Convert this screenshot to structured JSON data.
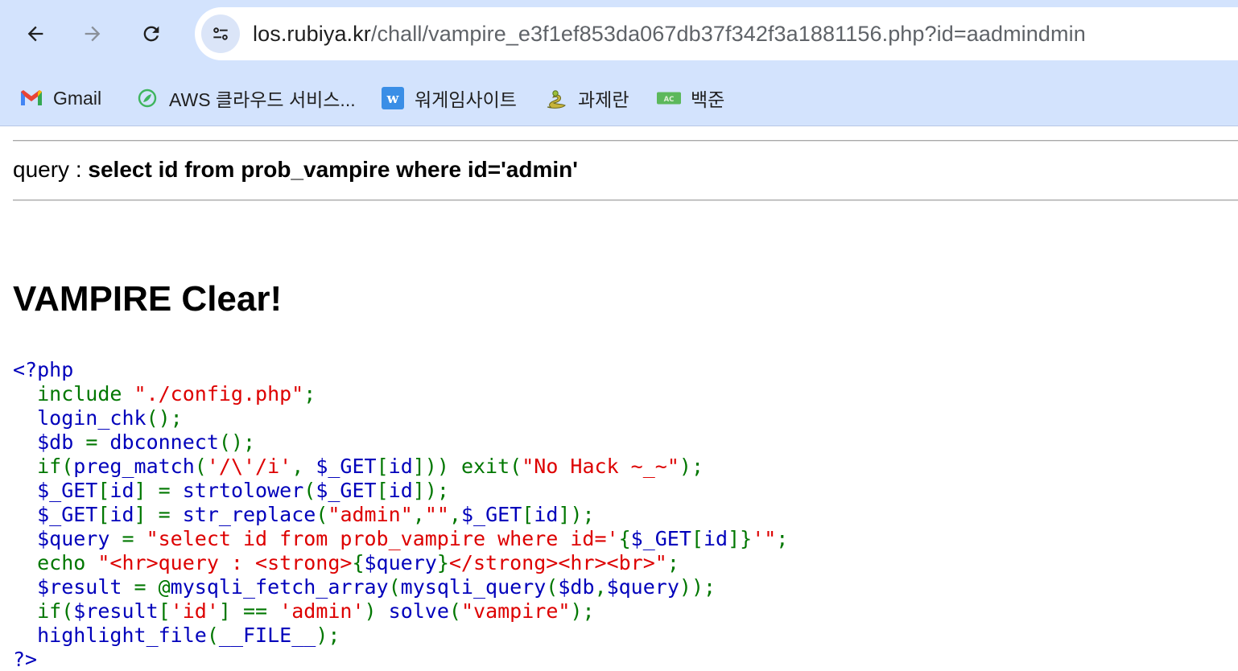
{
  "browser": {
    "url_host": "los.rubiya.kr",
    "url_path": "/chall/vampire_e3f1ef853da067db37f342f3a1881156.php?id=aadmindmin",
    "back_icon": "arrow-left-icon",
    "forward_icon": "arrow-right-icon",
    "reload_icon": "reload-icon",
    "site_info_icon": "tune-icon",
    "bookmarks": [
      {
        "label": "Gmail",
        "icon": "gmail-icon"
      },
      {
        "label": "AWS 클라우드 서비스...",
        "icon": "aws-leaf-icon"
      },
      {
        "label": "워게임사이트",
        "icon": "w-icon"
      },
      {
        "label": "과제란",
        "icon": "snake-icon"
      },
      {
        "label": "백준",
        "icon": "ac-icon"
      }
    ]
  },
  "page": {
    "query_prefix": "query : ",
    "query_text": "select id from prob_vampire where id='admin'",
    "clear_title": "VAMPIRE Clear!",
    "code_lines": [
      [
        [
          "d",
          "<?php"
        ]
      ],
      [
        [
          "k",
          "  include "
        ],
        [
          "s",
          "\"./config.php\""
        ],
        [
          "k",
          ";"
        ]
      ],
      [
        [
          "d",
          "  login_chk"
        ],
        [
          "k",
          "();"
        ]
      ],
      [
        [
          "d",
          "  $db "
        ],
        [
          "k",
          "= "
        ],
        [
          "d",
          "dbconnect"
        ],
        [
          "k",
          "();"
        ]
      ],
      [
        [
          "k",
          "  if("
        ],
        [
          "d",
          "preg_match"
        ],
        [
          "k",
          "("
        ],
        [
          "s",
          "'/\\'/i'"
        ],
        [
          "k",
          ", "
        ],
        [
          "d",
          "$_GET"
        ],
        [
          "k",
          "["
        ],
        [
          "d",
          "id"
        ],
        [
          "k",
          "])) exit("
        ],
        [
          "s",
          "\"No Hack ~_~\""
        ],
        [
          "k",
          ");"
        ]
      ],
      [
        [
          "d",
          "  $_GET"
        ],
        [
          "k",
          "["
        ],
        [
          "d",
          "id"
        ],
        [
          "k",
          "] = "
        ],
        [
          "d",
          "strtolower"
        ],
        [
          "k",
          "("
        ],
        [
          "d",
          "$_GET"
        ],
        [
          "k",
          "["
        ],
        [
          "d",
          "id"
        ],
        [
          "k",
          "]);"
        ]
      ],
      [
        [
          "d",
          "  $_GET"
        ],
        [
          "k",
          "["
        ],
        [
          "d",
          "id"
        ],
        [
          "k",
          "] = "
        ],
        [
          "d",
          "str_replace"
        ],
        [
          "k",
          "("
        ],
        [
          "s",
          "\"admin\""
        ],
        [
          "k",
          ","
        ],
        [
          "s",
          "\"\""
        ],
        [
          "k",
          ","
        ],
        [
          "d",
          "$_GET"
        ],
        [
          "k",
          "["
        ],
        [
          "d",
          "id"
        ],
        [
          "k",
          "]);"
        ]
      ],
      [
        [
          "d",
          "  $query "
        ],
        [
          "k",
          "= "
        ],
        [
          "s",
          "\"select id from prob_vampire where id='"
        ],
        [
          "k",
          "{"
        ],
        [
          "d",
          "$_GET"
        ],
        [
          "k",
          "["
        ],
        [
          "d",
          "id"
        ],
        [
          "k",
          "]}"
        ],
        [
          "s",
          "'\""
        ],
        [
          "k",
          ";"
        ]
      ],
      [
        [
          "k",
          "  echo "
        ],
        [
          "s",
          "\"<hr>query : <strong>"
        ],
        [
          "k",
          "{"
        ],
        [
          "d",
          "$query"
        ],
        [
          "k",
          "}"
        ],
        [
          "s",
          "</strong><hr><br>\""
        ],
        [
          "k",
          ";"
        ]
      ],
      [
        [
          "d",
          "  $result "
        ],
        [
          "k",
          "= @"
        ],
        [
          "d",
          "mysqli_fetch_array"
        ],
        [
          "k",
          "("
        ],
        [
          "d",
          "mysqli_query"
        ],
        [
          "k",
          "("
        ],
        [
          "d",
          "$db"
        ],
        [
          "k",
          ","
        ],
        [
          "d",
          "$query"
        ],
        [
          "k",
          "));"
        ]
      ],
      [
        [
          "k",
          "  if("
        ],
        [
          "d",
          "$result"
        ],
        [
          "k",
          "["
        ],
        [
          "s",
          "'id'"
        ],
        [
          "k",
          "] == "
        ],
        [
          "s",
          "'admin'"
        ],
        [
          "k",
          ") "
        ],
        [
          "d",
          "solve"
        ],
        [
          "k",
          "("
        ],
        [
          "s",
          "\"vampire\""
        ],
        [
          "k",
          ");"
        ]
      ],
      [
        [
          "d",
          "  highlight_file"
        ],
        [
          "k",
          "("
        ],
        [
          "d",
          "__FILE__"
        ],
        [
          "k",
          ");"
        ]
      ],
      [
        [
          "d",
          "?>"
        ]
      ]
    ]
  }
}
